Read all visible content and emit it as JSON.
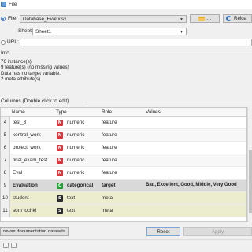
{
  "window": {
    "title": "File"
  },
  "source": {
    "file_label": "File:",
    "file_value": "Database_Eval.xlsx",
    "browse_label": "...",
    "reload_label": "Reloa",
    "sheet_label": "Sheet",
    "sheet_value": "Sheet1",
    "url_label": "URL:",
    "url_value": ""
  },
  "info": {
    "header": "Info",
    "lines": [
      "76 instance(s)",
      "9 feature(s) (no missing values)",
      "Data has no target variable.",
      "2 meta attribute(s)"
    ]
  },
  "columns": {
    "header": "Columns (Double click to edit)",
    "headers": {
      "name": "Name",
      "type": "Type",
      "role": "Role",
      "values": "Values"
    },
    "rows": [
      {
        "num": "4",
        "name": "test_3",
        "type": "numeric",
        "role": "feature",
        "values": "",
        "icon": "N"
      },
      {
        "num": "5",
        "name": "kontrol_work",
        "type": "numeric",
        "role": "feature",
        "values": "",
        "icon": "N"
      },
      {
        "num": "6",
        "name": "project_work",
        "type": "numeric",
        "role": "feature",
        "values": "",
        "icon": "N"
      },
      {
        "num": "7",
        "name": "final_exam_test",
        "type": "numeric",
        "role": "feature",
        "values": "",
        "icon": "N"
      },
      {
        "num": "8",
        "name": "Eval",
        "type": "numeric",
        "role": "feature",
        "values": "",
        "icon": "N"
      },
      {
        "num": "9",
        "name": "Evaluation",
        "type": "categorical",
        "role": "target",
        "values": "Bad, Excellent, Good, Middle, Very Good",
        "icon": "C"
      },
      {
        "num": "10",
        "name": "student",
        "type": "text",
        "role": "meta",
        "values": "",
        "icon": "S"
      },
      {
        "num": "11",
        "name": "sum tochki",
        "type": "text",
        "role": "meta",
        "values": "",
        "icon": "S"
      }
    ]
  },
  "buttons": {
    "browse_docs": "rowse documentation datasets",
    "reset": "Reset",
    "apply": "Apply"
  },
  "colors": {
    "numeric_icon": "#d9363e",
    "categorical_icon": "#2a9d3a",
    "text_icon": "#2b2b2b",
    "meta_row": "#ececcf",
    "target_row": "#d9d9d9"
  }
}
